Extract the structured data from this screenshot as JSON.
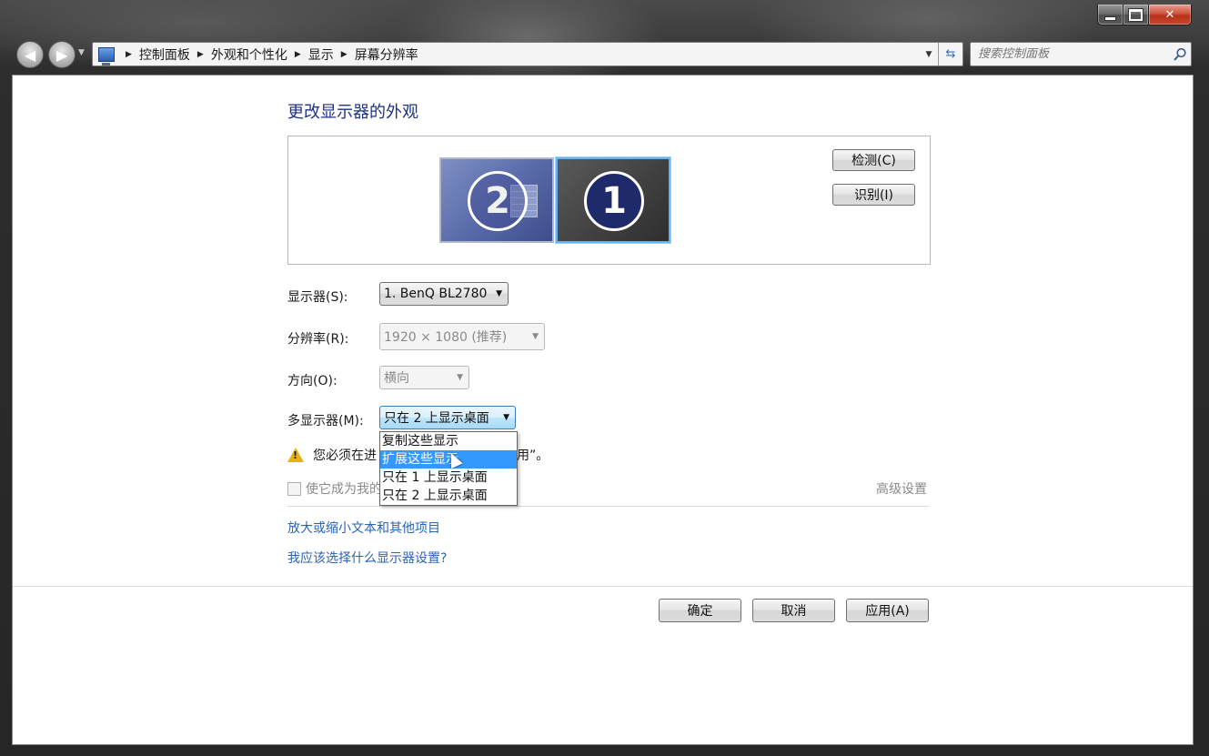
{
  "window": {
    "caption_buttons": [
      "minimize",
      "maximize",
      "close"
    ]
  },
  "nav": {
    "breadcrumbs": [
      "控制面板",
      "外观和个性化",
      "显示",
      "屏幕分辨率"
    ],
    "search_placeholder": "搜索控制面板"
  },
  "main": {
    "heading": "更改显示器的外观",
    "monitors": [
      {
        "number": "2",
        "selected": false
      },
      {
        "number": "1",
        "selected": true
      }
    ],
    "detect_label": "检测(C)",
    "identify_label": "识别(I)",
    "display_label": "显示器(S):",
    "display_value": "1. BenQ BL2780",
    "resolution_label": "分辨率(R):",
    "resolution_value": "1920 × 1080 (推荐)",
    "orientation_label": "方向(O):",
    "orientation_value": "横向",
    "multi_label": "多显示器(M):",
    "multi_value": "只在 2 上显示桌面",
    "multi_options": [
      "复制这些显示",
      "扩展这些显示",
      "只在 1 上显示桌面",
      "只在 2 上显示桌面"
    ],
    "multi_highlighted_option": "扩展这些显示",
    "warning_text_start": "您必须在进",
    "warning_text_end": "应用”。",
    "checkbox_label": "使它成为我的",
    "advanced_link": "高级设置",
    "link1": "放大或缩小文本和其他项目",
    "link2": "我应该选择什么显示器设置?",
    "ok_label": "确定",
    "cancel_label": "取消",
    "apply_label": "应用(A)"
  },
  "colors": {
    "heading": "#1e3287",
    "link": "#2a64b5",
    "selection": "#3399ff",
    "warning": "#e8b20e"
  }
}
